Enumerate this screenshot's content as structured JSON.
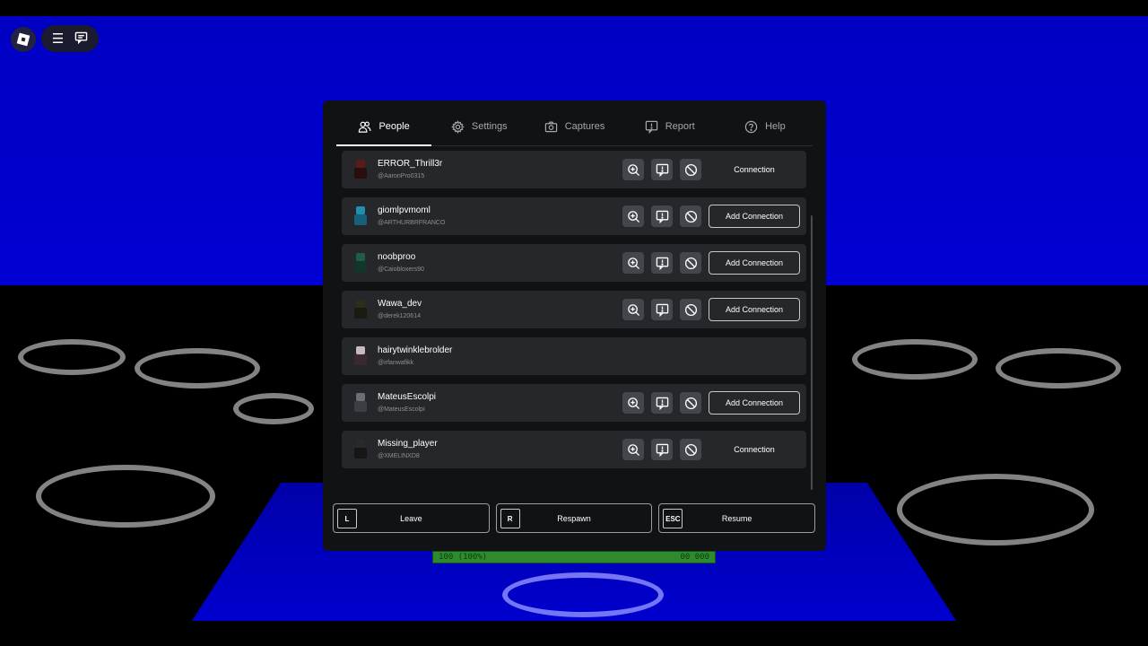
{
  "hud": {
    "menu_icon": "hamburger-icon",
    "chat_icon": "chat-icon",
    "logo_icon": "roblox-logo-icon"
  },
  "health_bar": {
    "left_text": "100 (100%)",
    "right_text": "00 000",
    "fill": 1.0
  },
  "tabs": [
    {
      "label": "People",
      "icon": "people-icon",
      "active": true
    },
    {
      "label": "Settings",
      "icon": "gear-icon",
      "active": false
    },
    {
      "label": "Captures",
      "icon": "camera-icon",
      "active": false
    },
    {
      "label": "Report",
      "icon": "report-icon",
      "active": false
    },
    {
      "label": "Help",
      "icon": "help-icon",
      "active": false
    }
  ],
  "players": [
    {
      "name": "ERROR_Thrill3r",
      "handle": "@AaronPro0315",
      "actions": true,
      "connection": "Connection",
      "outlined": false,
      "avatar_head": "#5a1a1a",
      "avatar_body": "#2a0e0e"
    },
    {
      "name": "giomlpvmoml",
      "handle": "@ARTHURBRFRANCO",
      "actions": true,
      "connection": "Add Connection",
      "outlined": true,
      "avatar_head": "#1f8fb0",
      "avatar_body": "#16607a"
    },
    {
      "name": "noobproo",
      "handle": "@Caiobloxers90",
      "actions": true,
      "connection": "Add Connection",
      "outlined": true,
      "avatar_head": "#1e5e48",
      "avatar_body": "#12362a"
    },
    {
      "name": "Wawa_dev",
      "handle": "@derek120614",
      "actions": true,
      "connection": "Add Connection",
      "outlined": true,
      "avatar_head": "#2c2e1a",
      "avatar_body": "#1a1b10"
    },
    {
      "name": "hairytwinklebrolder",
      "handle": "@irfanwafikk",
      "actions": false,
      "connection": "",
      "outlined": false,
      "avatar_head": "#c8b8c0",
      "avatar_body": "#3a2a30"
    },
    {
      "name": "MateusEscolpi",
      "handle": "@MateusEscolpi",
      "actions": true,
      "connection": "Add Connection",
      "outlined": true,
      "avatar_head": "#6c6e74",
      "avatar_body": "#3c3e44"
    },
    {
      "name": "Missing_player",
      "handle": "@XMELINXD8",
      "actions": true,
      "connection": "Connection",
      "outlined": false,
      "avatar_head": "#2a2a2a",
      "avatar_body": "#161616"
    }
  ],
  "footer": [
    {
      "key": "L",
      "label": "Leave"
    },
    {
      "key": "R",
      "label": "Respawn"
    },
    {
      "key": "ESC",
      "label": "Resume"
    }
  ],
  "colors": {
    "panel_bg": "#111214",
    "row_bg": "#26272b",
    "icon_button_bg": "#45464b",
    "sky": "#0000c8"
  }
}
